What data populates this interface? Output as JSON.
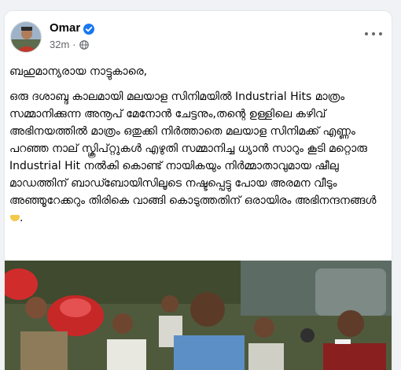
{
  "post": {
    "author": "Omar",
    "time": "32m",
    "separator": "·",
    "greeting": "ബഹുമാന്യരായ നാട്ടുകാരെ,",
    "body": "ഒരു ദശാബ്ദ കാലമായി മലയാള സിനിമയിൽ Industrial Hits മാത്രം സമ്മാനിക്കുന്ന അനൂപ് മേനോൻ ചേട്ടനും,തന്റെ ഉള്ളിലെ കഴിവ് അഭിനയത്തിൽ മാത്രം ഒതുക്കി നിർത്താതെ മലയാള സിനിമക്ക് എണ്ണം പറഞ്ഞ നാല് സ്ക്രിപ്റ്റുകൾ എഴുതി സമ്മാനിച്ച ധ്യാൻ സാറും കൂടി മറ്റൊരു Industrial Hit നൽകി കൊണ്ട് നായികയും നിർമ്മാതാവുമായ ഷീലു മാഡത്തിന് ബാഡ്ബോയിസിലൂടെ നഷ്ടപ്പെട്ടു പോയ അരമന വീടും അഞ്ഞൂറേക്കറും തിരികെ വാങ്ങി കൊടുത്തതിന് ഒരായിരം അഭിനന്ദനങ്ങൾ",
    "ending": "."
  },
  "icons": {
    "verified": "verified-badge-icon",
    "audience": "globe-icon",
    "more": "more-options-icon",
    "emoji": "clapping-hands-emoji"
  },
  "colors": {
    "verified": "#1877f2",
    "meta_text": "#65676b",
    "text": "#050505",
    "background": "#f0f2f5"
  }
}
